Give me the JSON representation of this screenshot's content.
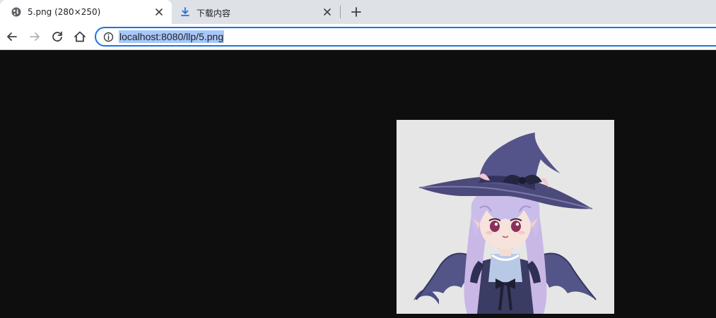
{
  "tabs": [
    {
      "title": "5.png (280×250)",
      "icon": "globe-icon",
      "active": true
    },
    {
      "title": "下载内容",
      "icon": "download-icon",
      "active": false
    }
  ],
  "toolbar": {
    "back_icon": "back-arrow-icon",
    "forward_icon": "forward-arrow-icon",
    "reload_icon": "reload-icon",
    "home_icon": "home-icon"
  },
  "address_bar": {
    "url": "localhost:8080/llp/5.png",
    "security_icon": "info-icon",
    "selected": true
  },
  "content": {
    "image_alt": "anime witch girl with purple hat and bat wings",
    "image_background": "#e6e6e6",
    "page_background": "#0e0e0e"
  },
  "colors": {
    "accent": "#1a73e8",
    "selection": "#a8c7fa",
    "tabstrip": "#dee1e6"
  }
}
